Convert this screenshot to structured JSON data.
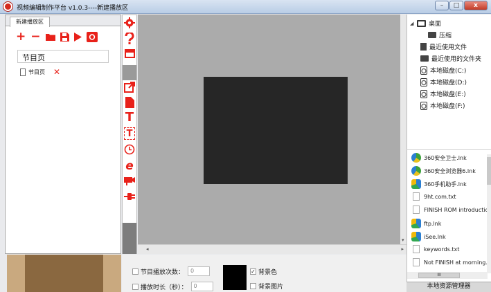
{
  "window": {
    "title": "视频编辑制作平台 v1.0.3----新建播放区",
    "minimize_label": "–",
    "maximize_label": "□",
    "close_label": "x"
  },
  "left_panel": {
    "tab_label": "新建播放区",
    "program_name_value": "节目页",
    "program_items": [
      {
        "label": "节目页",
        "remove_label": "✕"
      }
    ]
  },
  "icons": {
    "add": "plus-icon",
    "remove": "minus-icon",
    "open": "folder-open-icon",
    "save": "floppy-disk-icon",
    "play": "play-icon",
    "record": "stop-record-icon"
  },
  "tools": {
    "add_label": "+",
    "remove_label": "−"
  },
  "vtoolbar": {
    "text_label": "T",
    "textbox_label": "T",
    "browser_label": "e"
  },
  "canvas": {
    "screen_color": "#262626",
    "background_color": "#ababab"
  },
  "tree": {
    "items": [
      {
        "label": "桌面",
        "expander": "◢"
      },
      {
        "label": "压缩"
      },
      {
        "label": "最近使用文件"
      },
      {
        "label": "最近使用的文件夹"
      },
      {
        "label": "本地磁盘(C:)"
      },
      {
        "label": "本地磁盘(D:)"
      },
      {
        "label": "本地磁盘(E:)"
      },
      {
        "label": "本地磁盘(F:)"
      }
    ]
  },
  "files": {
    "items": [
      {
        "label": "360安全卫士.lnk"
      },
      {
        "label": "360安全浏览器6.lnk"
      },
      {
        "label": "360手机助手.lnk"
      },
      {
        "label": "9ht.com.txt"
      },
      {
        "label": "FINISH ROM introductio"
      },
      {
        "label": "ftp.lnk"
      },
      {
        "label": "iSee.lnk"
      },
      {
        "label": "keywords.txt"
      },
      {
        "label": "Not FINISH at morning."
      }
    ],
    "hscroll_label": "III",
    "explorer_label": "本地资源管理器"
  },
  "properties": {
    "play_count_label": "节目播放次数：",
    "play_count_value": "0",
    "duration_label": "播放时长（秒）：",
    "duration_value": "0",
    "bg_color_label": "背景色",
    "bg_color_checked": "✓",
    "bg_image_label": "背景图片",
    "swatch_color": "#000000"
  }
}
